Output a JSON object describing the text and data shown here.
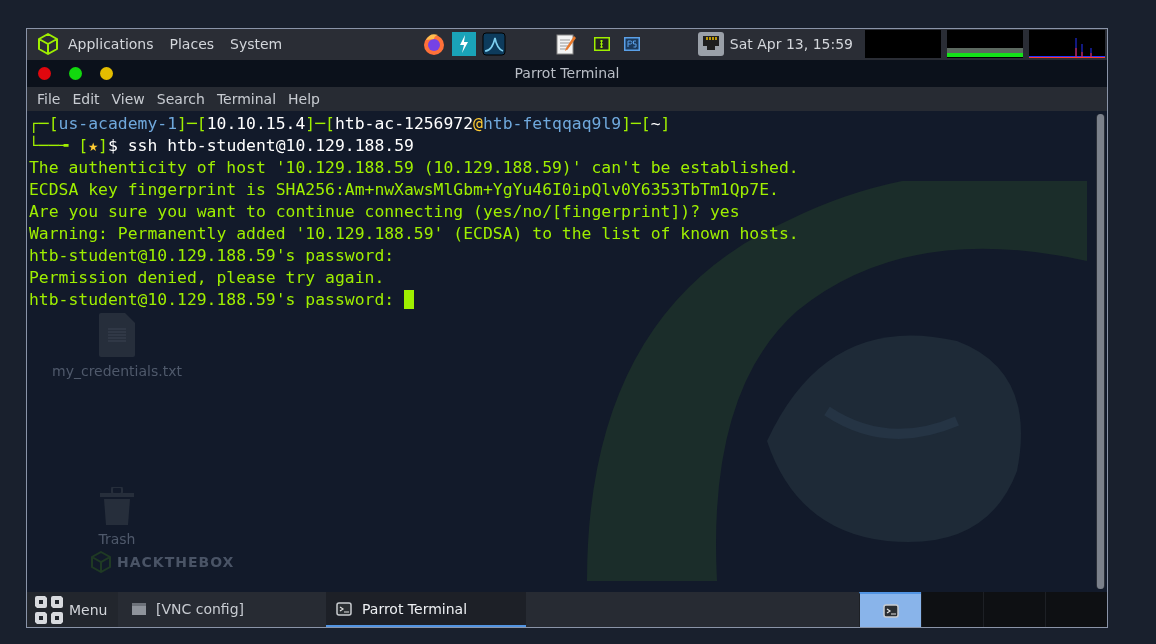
{
  "top_panel": {
    "menus": [
      "Applications",
      "Places",
      "System"
    ],
    "clock": "Sat Apr 13, 15:59"
  },
  "window": {
    "title": "Parrot Terminal",
    "menu": [
      "File",
      "Edit",
      "View",
      "Search",
      "Terminal",
      "Help"
    ]
  },
  "terminal": {
    "prompt": [
      {
        "text": "┌─[",
        "color": "#9fef00"
      },
      {
        "text": "us-academy-1",
        "color": "#6fa8dc"
      },
      {
        "text": "]─[",
        "color": "#9fef00"
      },
      {
        "text": "10.10.15.4",
        "color": "#ffffff"
      },
      {
        "text": "]─[",
        "color": "#9fef00"
      },
      {
        "text": "htb-ac-1256972",
        "color": "#ffffff"
      },
      {
        "text": "@",
        "color": "#ffcc33"
      },
      {
        "text": "htb-fetqqaq9l9",
        "color": "#6fa8dc"
      },
      {
        "text": "]─[",
        "color": "#9fef00"
      },
      {
        "text": "~",
        "color": "#ffffff"
      },
      {
        "text": "]",
        "color": "#9fef00"
      }
    ],
    "command_line": [
      {
        "text": "└──╼ ",
        "color": "#9fef00"
      },
      {
        "text": "[",
        "color": "#9fef00"
      },
      {
        "text": "★",
        "color": "#ffcc33"
      },
      {
        "text": "]",
        "color": "#9fef00"
      },
      {
        "text": "$ ssh htb-student@10.129.188.59",
        "color": "#ffffff"
      }
    ],
    "output": [
      "The authenticity of host '10.129.188.59 (10.129.188.59)' can't be established.",
      "ECDSA key fingerprint is SHA256:Am+nwXawsMlGbm+YgYu46I0ipQlv0Y6353TbTm1Qp7E.",
      "Are you sure you want to continue connecting (yes/no/[fingerprint])? yes",
      "Warning: Permanently added '10.129.188.59' (ECDSA) to the list of known hosts.",
      "htb-student@10.129.188.59's password:",
      "Permission denied, please try again.",
      "htb-student@10.129.188.59's password: "
    ]
  },
  "desktop": {
    "icons": [
      {
        "label": "my_credentials.txt",
        "kind": "file"
      },
      {
        "label": "Trash",
        "kind": "trash"
      }
    ],
    "logo": "HACKTHEBOX"
  },
  "taskbar": {
    "menu_label": "Menu",
    "tasks": [
      {
        "label": "[VNC config]",
        "selected": false
      },
      {
        "label": "Parrot Terminal",
        "selected": true
      }
    ],
    "workspaces": [
      {
        "selected": true
      },
      {
        "selected": false
      },
      {
        "selected": false
      },
      {
        "selected": false
      }
    ]
  }
}
